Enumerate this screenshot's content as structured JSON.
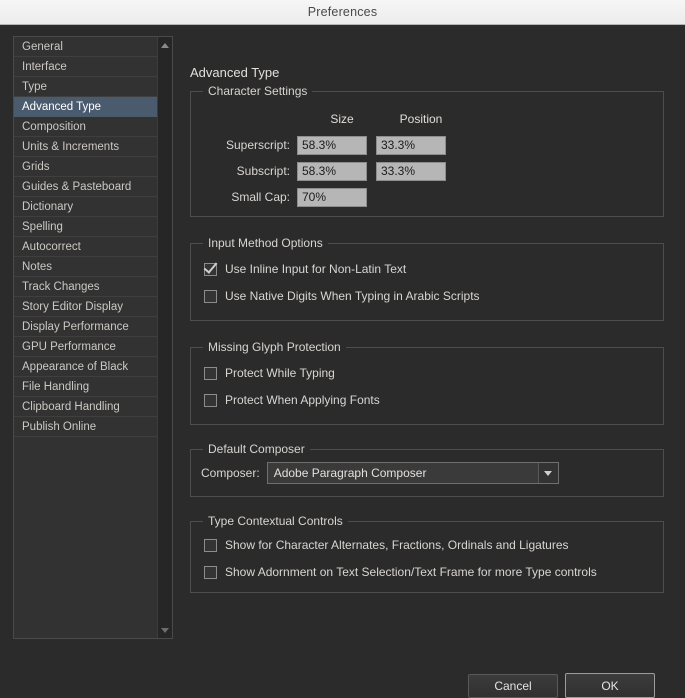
{
  "window": {
    "title": "Preferences"
  },
  "sidebar": {
    "items": [
      {
        "label": "General",
        "selected": false
      },
      {
        "label": "Interface",
        "selected": false
      },
      {
        "label": "Type",
        "selected": false
      },
      {
        "label": "Advanced Type",
        "selected": true
      },
      {
        "label": "Composition",
        "selected": false
      },
      {
        "label": "Units & Increments",
        "selected": false
      },
      {
        "label": "Grids",
        "selected": false
      },
      {
        "label": "Guides & Pasteboard",
        "selected": false
      },
      {
        "label": "Dictionary",
        "selected": false
      },
      {
        "label": "Spelling",
        "selected": false
      },
      {
        "label": "Autocorrect",
        "selected": false
      },
      {
        "label": "Notes",
        "selected": false
      },
      {
        "label": "Track Changes",
        "selected": false
      },
      {
        "label": "Story Editor Display",
        "selected": false
      },
      {
        "label": "Display Performance",
        "selected": false
      },
      {
        "label": "GPU Performance",
        "selected": false
      },
      {
        "label": "Appearance of Black",
        "selected": false
      },
      {
        "label": "File Handling",
        "selected": false
      },
      {
        "label": "Clipboard Handling",
        "selected": false
      },
      {
        "label": "Publish Online",
        "selected": false
      }
    ],
    "scroll_up_icon": "triangle-up-icon",
    "scroll_down_icon": "triangle-down-icon"
  },
  "pane": {
    "title": "Advanced Type",
    "character_settings": {
      "title": "Character Settings",
      "column_headers": {
        "size": "Size",
        "position": "Position"
      },
      "rows": [
        {
          "label": "Superscript:",
          "size": "58.3%",
          "position": "33.3%"
        },
        {
          "label": "Subscript:",
          "size": "58.3%",
          "position": "33.3%"
        },
        {
          "label": "Small Cap:",
          "size": "70%",
          "position": null
        }
      ]
    },
    "input_method_options": {
      "title": "Input Method Options",
      "options": [
        {
          "label": "Use Inline Input for Non-Latin Text",
          "checked": true
        },
        {
          "label": "Use Native Digits When Typing in Arabic Scripts",
          "checked": false
        }
      ]
    },
    "missing_glyph_protection": {
      "title": "Missing Glyph Protection",
      "options": [
        {
          "label": "Protect While Typing",
          "checked": false
        },
        {
          "label": "Protect When Applying Fonts",
          "checked": false
        }
      ]
    },
    "default_composer": {
      "title": "Default Composer",
      "label": "Composer:",
      "value": "Adobe Paragraph Composer",
      "dropdown_icon": "chevron-down-icon"
    },
    "type_contextual_controls": {
      "title": "Type Contextual Controls",
      "options": [
        {
          "label": "Show for Character Alternates, Fractions, Ordinals and Ligatures",
          "checked": false
        },
        {
          "label": "Show Adornment on Text Selection/Text Frame for more Type controls",
          "checked": false
        }
      ]
    }
  },
  "footer": {
    "cancel_label": "Cancel",
    "ok_label": "OK"
  },
  "colors": {
    "window_background": "#2b2b2b",
    "titlebar_background": "#f2f2f2",
    "selection": "#4b5b6e",
    "input_background": "#b6b6b6",
    "group_border": "#4d4d4d"
  }
}
